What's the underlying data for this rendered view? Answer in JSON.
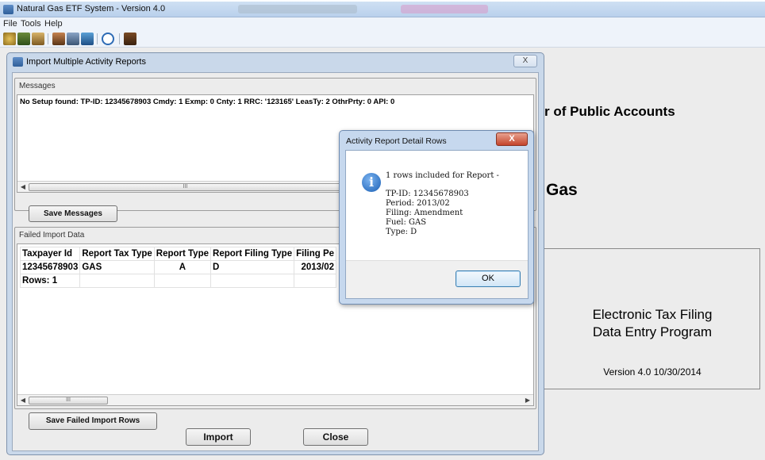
{
  "app": {
    "title": "Natural Gas ETF System - Version 4.0"
  },
  "menu": {
    "file": "File",
    "tools": "Tools",
    "help": "Help"
  },
  "toolbar": {
    "icons": [
      "open-icon",
      "save-icon",
      "report-icon",
      "import-icon",
      "copy-icon",
      "print-icon",
      "help-icon",
      "exit-icon"
    ]
  },
  "background": {
    "heading1": "r of Public Accounts",
    "heading2": "Gas",
    "box_line1": "Electronic Tax Filing",
    "box_line2": "Data Entry Program",
    "version": "Version 4.0  10/30/2014"
  },
  "import_dialog": {
    "title": "Import Multiple Activity Reports",
    "close_label": "X",
    "messages_label": "Messages",
    "message_text": "No Setup found:  TP-ID: 12345678903 Cmdy: 1 Exmp: 0 Cnty: 1 RRC: '123165' LeasTy: 2 OthrPrty: 0 API: 0",
    "save_messages_label": "Save Messages",
    "failed_label": "Failed Import Data",
    "columns": [
      "Taxpayer Id",
      "Report Tax Type",
      "Report Type",
      "Report Filing Type",
      "Filing Pe"
    ],
    "rows": [
      [
        "12345678903",
        "GAS",
        "A",
        "D",
        "2013/02"
      ]
    ],
    "rows_count": "Rows: 1",
    "save_failed_label": "Save Failed Import Rows",
    "import_label": "Import",
    "close_button_label": "Close",
    "scroll_thumb": "III"
  },
  "message_box": {
    "title": "Activity Report Detail Rows",
    "close_label": "X",
    "line1": "1 rows included for Report -",
    "tpid": "TP-ID:  12345678903",
    "period": "Period:  2013/02",
    "filing": "Filing:  Amendment",
    "fuel": "Fuel:    GAS",
    "type": "Type:    D",
    "ok_label": "OK",
    "info_glyph": "i"
  },
  "colors": {
    "title_bar": "#cfe0f3",
    "dialog_frame": "#c9d8ea",
    "window_face": "#ececec",
    "close_red": "#c4452c"
  }
}
